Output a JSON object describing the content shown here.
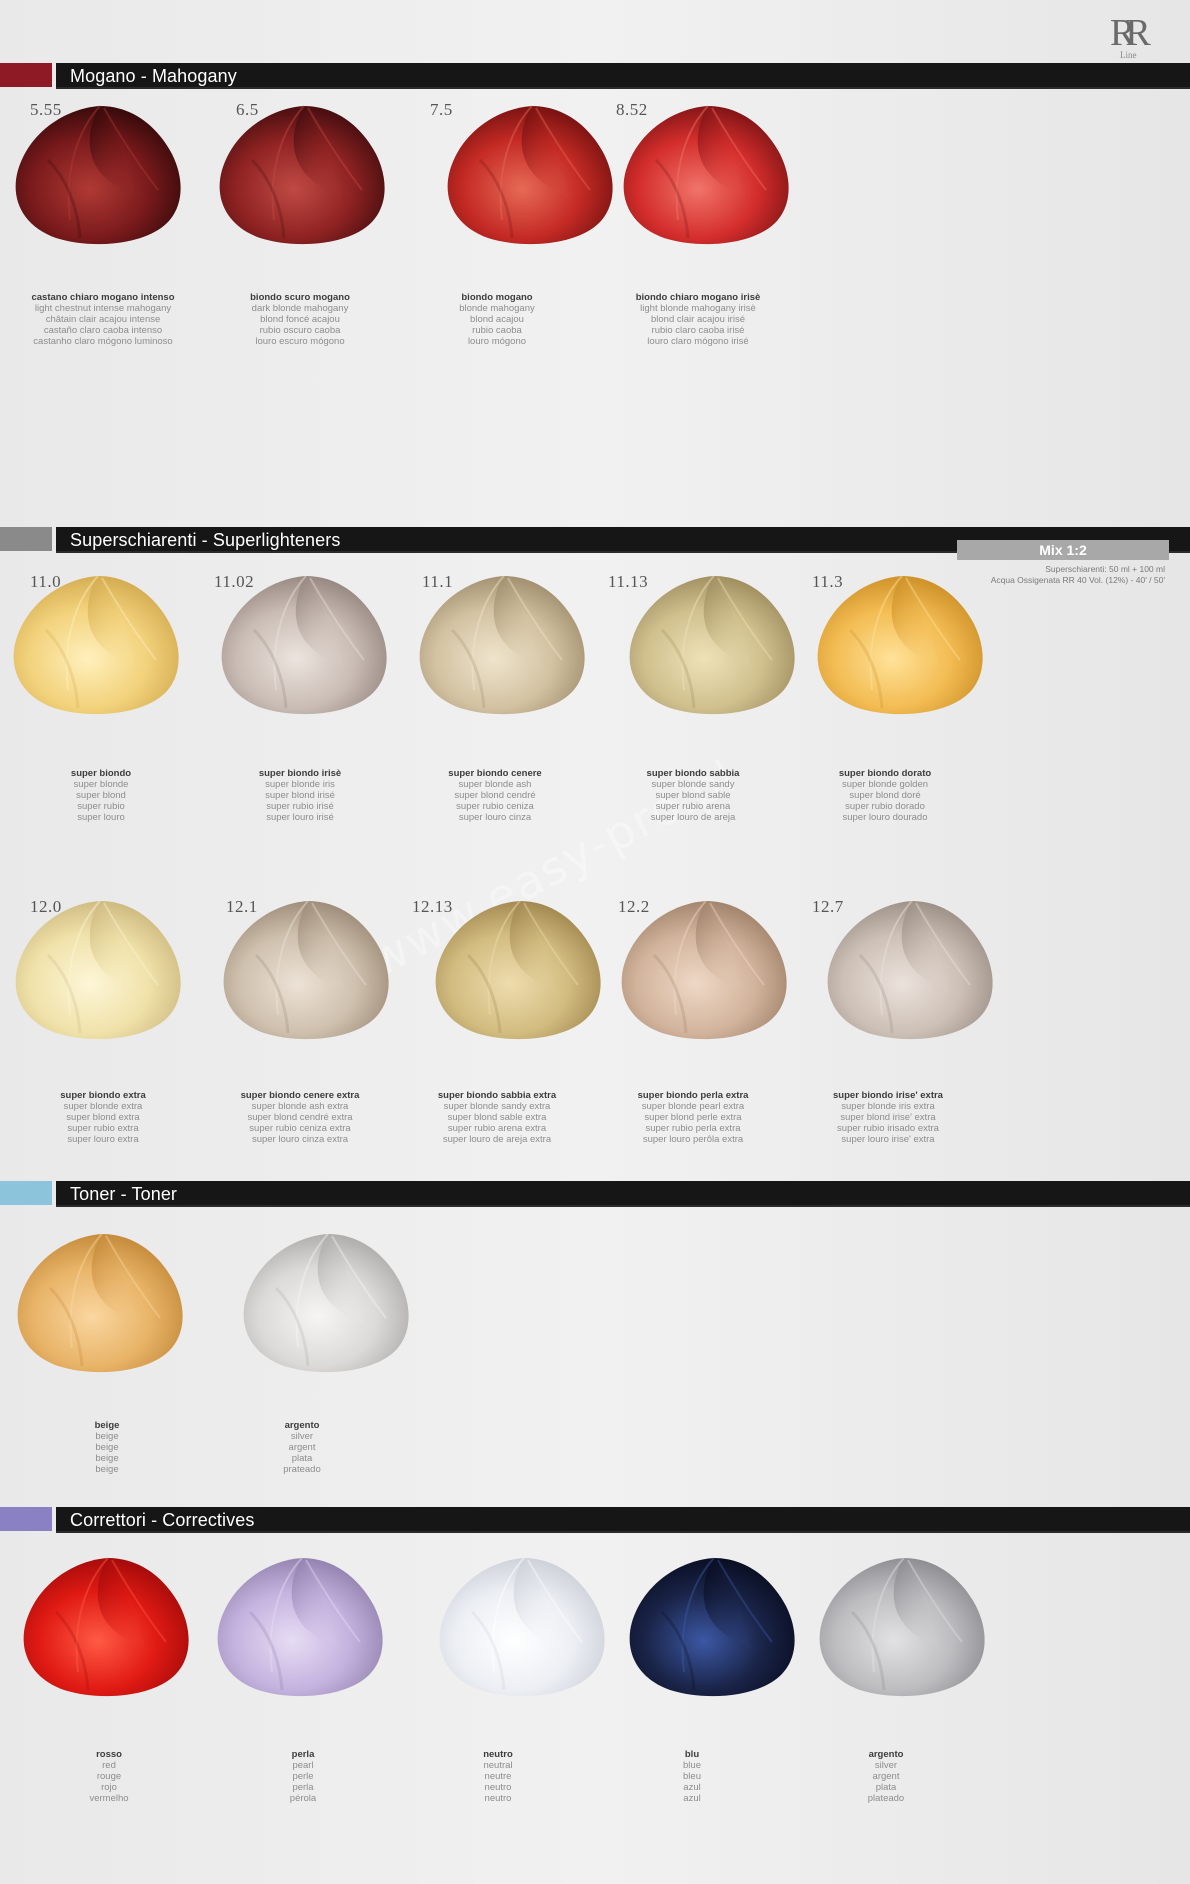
{
  "logo": {
    "mark": "RR",
    "line": "Line"
  },
  "sections": [
    {
      "title": "Mogano - Mahogany",
      "tab_color": "#8e1a26"
    },
    {
      "title": "Superschiarenti - Superlighteners",
      "tab_color": "#8a8a8a"
    },
    {
      "title": "Toner - Toner",
      "tab_color": "#8cc4dc"
    },
    {
      "title": "Correttori - Correctives",
      "tab_color": "#8a80c4"
    }
  ],
  "mix": {
    "title": "Mix 1:2",
    "line1": "Superschiarenti: 50 ml + 100 ml",
    "line2": "Acqua Ossigenata RR 40 Vol. (12%) - 40' / 50'"
  },
  "watermark": "www.easy-pro.pl",
  "swatches": [
    {
      "code": "5.55",
      "color": "#7a1a1c",
      "dark": "#2b0708",
      "light": "#b03a34",
      "lines": [
        "castano chiaro mogano intenso",
        "light chestnut intense mahogany",
        "châtain clair acajou intense",
        "castaño claro caoba intenso",
        "castanho claro mógono luminoso"
      ]
    },
    {
      "code": "6.5",
      "color": "#8e2222",
      "dark": "#3a0a0c",
      "light": "#c04a44",
      "lines": [
        "biondo scuro mogano",
        "dark blonde mahogany",
        "blond foncé acajou",
        "rubio oscuro caoba",
        "louro escuro mógono"
      ]
    },
    {
      "code": "7.5",
      "color": "#c42a24",
      "dark": "#6a0e0e",
      "light": "#e66a56",
      "lines": [
        "biondo mogano",
        "blonde mahogany",
        "blond acajou",
        "rubio caoba",
        "louro mógono"
      ]
    },
    {
      "code": "8.52",
      "color": "#d42e2c",
      "dark": "#741012",
      "light": "#f0746a",
      "lines": [
        "biondo chiaro mogano irisè",
        "light blonde mahogany irisè",
        "blond clair acajou irisé",
        "rubio claro caoba irisé",
        "louro claro mógono irisé"
      ]
    },
    {
      "code": "11.0",
      "color": "#f2d27c",
      "dark": "#cfa64a",
      "light": "#fff0bc",
      "lines": [
        "super biondo",
        "super blonde",
        "super blond",
        "super rubio",
        "super louro"
      ]
    },
    {
      "code": "11.02",
      "color": "#c9bcb4",
      "dark": "#8e8078",
      "light": "#ece4de",
      "lines": [
        "super biondo irisè",
        "super blonde iris",
        "super blond irisé",
        "super rubio irisé",
        "super louro irisé"
      ]
    },
    {
      "code": "11.1",
      "color": "#d2c2a2",
      "dark": "#9a8868",
      "light": "#efe4cc",
      "lines": [
        "super biondo cenere",
        "super blonde ash",
        "super blond cendré",
        "super rubio ceniza",
        "super louro cinza"
      ]
    },
    {
      "code": "11.13",
      "color": "#d0c08e",
      "dark": "#988658",
      "light": "#eee2b8",
      "lines": [
        "super biondo sabbia",
        "super blonde sandy",
        "super blond sable",
        "super rubio arena",
        "super louro de areja"
      ]
    },
    {
      "code": "11.3",
      "color": "#f2bc52",
      "dark": "#c88a22",
      "light": "#ffe29a",
      "lines": [
        "super biondo dorato",
        "super blonde golden",
        "super blond doré",
        "super rubio dorado",
        "super louro dourado"
      ]
    },
    {
      "code": "12.0",
      "color": "#f0e2aa",
      "dark": "#c8b47a",
      "light": "#fdf6d8",
      "lines": [
        "super biondo extra",
        "super blonde extra",
        "super blond extra",
        "super rubio extra",
        "super louro extra"
      ]
    },
    {
      "code": "12.1",
      "color": "#cfc0ae",
      "dark": "#958470",
      "light": "#ece2d6",
      "lines": [
        "super biondo cenere extra",
        "super blonde ash extra",
        "super blond cendré extra",
        "super rubio ceniza extra",
        "super louro cinza extra"
      ]
    },
    {
      "code": "12.13",
      "color": "#d2bc80",
      "dark": "#9a8048",
      "light": "#eedcae",
      "lines": [
        "super biondo sabbia extra",
        "super blonde sandy extra",
        "super blond sable extra",
        "super rubio arena extra",
        "super louro de areja extra"
      ]
    },
    {
      "code": "12.2",
      "color": "#d2b49c",
      "dark": "#9a7c64",
      "light": "#eed8c6",
      "lines": [
        "super biondo perla extra",
        "super blonde pearl extra",
        "super blond perle extra",
        "super rubio perla extra",
        "super louro perôla extra"
      ]
    },
    {
      "code": "12.7",
      "color": "#cdc0b6",
      "dark": "#958880",
      "light": "#ebe2dc",
      "lines": [
        "super biondo irise' extra",
        "super blonde iris extra",
        "super blond irise' extra",
        "super rubio irisado extra",
        "super louro irise' extra"
      ]
    },
    {
      "code": "",
      "color": "#e8b468",
      "dark": "#c08434",
      "light": "#fad6a0",
      "lines": [
        "beige",
        "beige",
        "beige",
        "beige",
        "beige"
      ]
    },
    {
      "code": "",
      "color": "#dcdad8",
      "dark": "#a8a6a4",
      "light": "#f6f5f4",
      "lines": [
        "argento",
        "silver",
        "argent",
        "plata",
        "prateado"
      ]
    },
    {
      "code": "",
      "color": "#e01a14",
      "dark": "#9a0808",
      "light": "#ff5a44",
      "lines": [
        "rosso",
        "red",
        "rouge",
        "rojo",
        "vermelho"
      ]
    },
    {
      "code": "",
      "color": "#c4b2de",
      "dark": "#8c7aa8",
      "light": "#e6dcf4",
      "lines": [
        "perla",
        "pearl",
        "perle",
        "perla",
        "pérola"
      ]
    },
    {
      "code": "",
      "color": "#eceff4",
      "dark": "#c8ccd4",
      "light": "#ffffff",
      "lines": [
        "neutro",
        "neutral",
        "neutre",
        "neutro",
        "neutro"
      ]
    },
    {
      "code": "",
      "color": "#1a2448",
      "dark": "#060a1c",
      "light": "#3c58a4",
      "lines": [
        "blu",
        "blue",
        "bleu",
        "azul",
        "azul"
      ]
    },
    {
      "code": "",
      "color": "#bdbdc0",
      "dark": "#86868a",
      "light": "#e2e2e4",
      "lines": [
        "argento",
        "silver",
        "argent",
        "plata",
        "plateado"
      ]
    }
  ]
}
